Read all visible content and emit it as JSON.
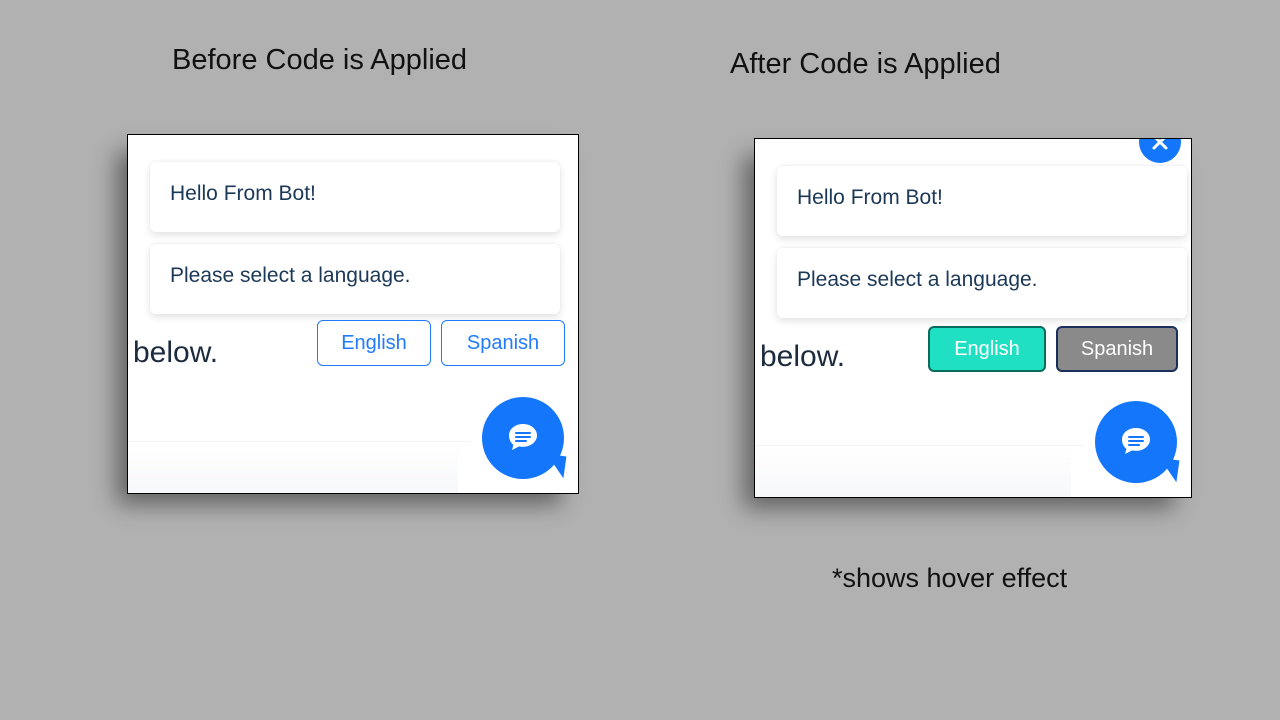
{
  "headings": {
    "before": "Before Code is Applied",
    "after": "After Code is Applied"
  },
  "caption": "*shows hover effect",
  "messages": {
    "greeting": "Hello From Bot!",
    "prompt": "Please select a language."
  },
  "stray_text": "below.",
  "buttons": {
    "english": "English",
    "spanish": "Spanish"
  },
  "colors": {
    "accent_blue": "#1477fb",
    "button_outline": "#207bff",
    "after_primary_bg": "#1fe0c2",
    "after_secondary_bg": "#8a8a8a",
    "text_primary": "#1b3857"
  },
  "icons": {
    "chat": "chat-icon",
    "close": "close-icon"
  }
}
